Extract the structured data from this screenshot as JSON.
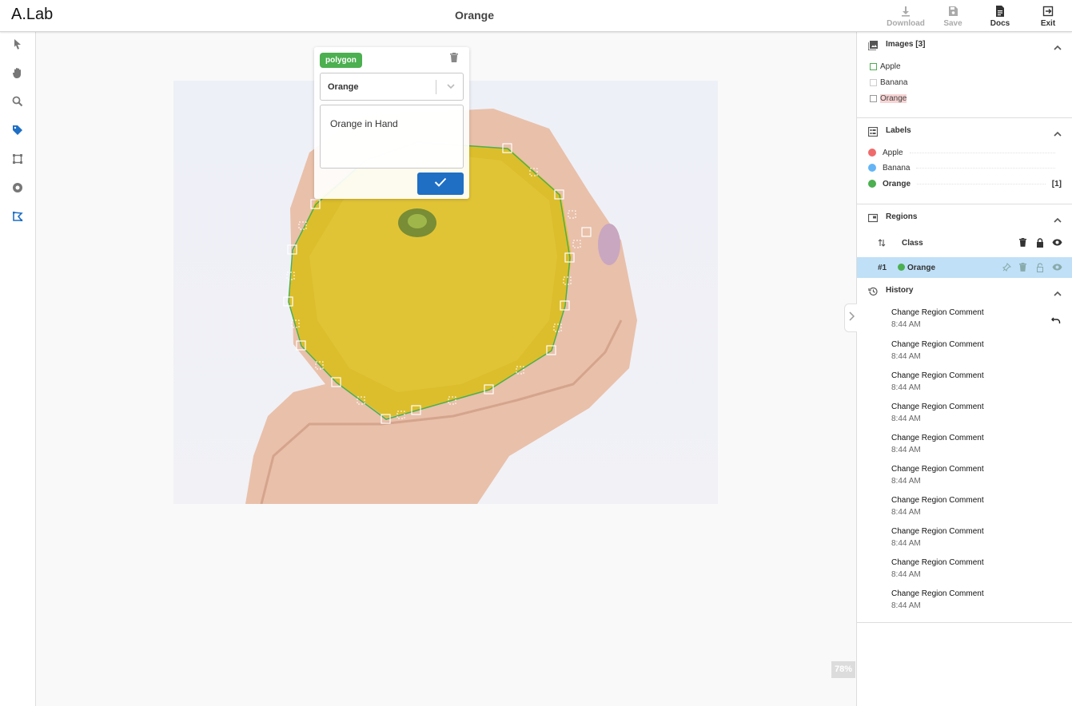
{
  "app": {
    "brand": "A.Lab",
    "title": "Orange"
  },
  "header_buttons": [
    {
      "label": "Download",
      "icon": "download-icon",
      "enabled": false
    },
    {
      "label": "Save",
      "icon": "save-icon",
      "enabled": false
    },
    {
      "label": "Docs",
      "icon": "docs-icon",
      "enabled": true
    },
    {
      "label": "Exit",
      "icon": "exit-icon",
      "enabled": true
    }
  ],
  "tools": [
    {
      "name": "select-tool",
      "icon": "cursor-icon",
      "active": false
    },
    {
      "name": "pan-tool",
      "icon": "hand-icon",
      "active": false
    },
    {
      "name": "zoom-tool",
      "icon": "search-icon",
      "active": false
    },
    {
      "name": "tag-tool",
      "icon": "tag-icon",
      "active": true
    },
    {
      "name": "box-tool",
      "icon": "bounding-box-icon",
      "active": false
    },
    {
      "name": "circle-tool",
      "icon": "circle-icon",
      "active": false
    },
    {
      "name": "polygon-tool",
      "icon": "polygon-icon",
      "active": true
    }
  ],
  "editor": {
    "type_tag": "polygon",
    "class_value": "Orange",
    "comment": "Orange in Hand",
    "tag_color": "#4caf50",
    "confirm_color": "#1f6fc5"
  },
  "zoom_level": "78%",
  "images_panel": {
    "title": "Images [3]",
    "items": [
      {
        "label": "Apple",
        "selected": false,
        "box_color": "#4caf50"
      },
      {
        "label": "Banana",
        "selected": false,
        "box_color": "#cccccc"
      },
      {
        "label": "Orange",
        "selected": true,
        "box_color": "#999999"
      }
    ]
  },
  "labels_panel": {
    "title": "Labels",
    "items": [
      {
        "label": "Apple",
        "color": "#ef6b6b",
        "count": ""
      },
      {
        "label": "Banana",
        "color": "#64b5f6",
        "count": ""
      },
      {
        "label": "Orange",
        "color": "#4caf50",
        "count": "[1]",
        "selected": true
      }
    ]
  },
  "regions_panel": {
    "title": "Regions",
    "column_class": "Class",
    "rows": [
      {
        "id": "#1",
        "label": "Orange",
        "color": "#4caf50"
      }
    ]
  },
  "history_panel": {
    "title": "History",
    "items": [
      {
        "action": "Change Region Comment",
        "time": "8:44 AM"
      },
      {
        "action": "Change Region Comment",
        "time": "8:44 AM"
      },
      {
        "action": "Change Region Comment",
        "time": "8:44 AM"
      },
      {
        "action": "Change Region Comment",
        "time": "8:44 AM"
      },
      {
        "action": "Change Region Comment",
        "time": "8:44 AM"
      },
      {
        "action": "Change Region Comment",
        "time": "8:44 AM"
      },
      {
        "action": "Change Region Comment",
        "time": "8:44 AM"
      },
      {
        "action": "Change Region Comment",
        "time": "8:44 AM"
      },
      {
        "action": "Change Region Comment",
        "time": "8:44 AM"
      },
      {
        "action": "Change Region Comment",
        "time": "8:44 AM"
      }
    ]
  }
}
